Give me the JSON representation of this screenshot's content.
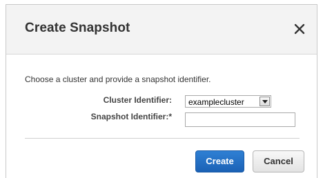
{
  "dialog": {
    "title": "Create Snapshot",
    "close_icon": "close-icon",
    "instructions": "Choose a cluster and provide a snapshot identifier.",
    "fields": {
      "cluster_label": "Cluster Identifier:",
      "cluster_value": "examplecluster",
      "snapshot_label": "Snapshot Identifier:*",
      "snapshot_value": ""
    },
    "buttons": {
      "create_label": "Create",
      "cancel_label": "Cancel"
    }
  },
  "colors": {
    "primary_button": "#1b62b5",
    "header_bg": "#f3f3f3"
  }
}
